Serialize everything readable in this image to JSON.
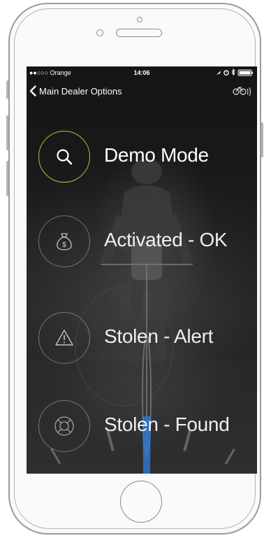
{
  "status_bar": {
    "carrier": "●●○○○ Orange",
    "time": "14:06"
  },
  "nav": {
    "back_label": "Main Dealer Options"
  },
  "menu": [
    {
      "label": "Demo Mode",
      "icon": "search-icon",
      "active": true
    },
    {
      "label": "Activated - OK",
      "icon": "money-bag-icon",
      "active": false
    },
    {
      "label": "Stolen - Alert",
      "icon": "warning-icon",
      "active": false
    },
    {
      "label": "Stolen - Found",
      "icon": "lifebuoy-icon",
      "active": false
    }
  ],
  "colors": {
    "active_ring": "#c6bb3c",
    "accent_blue": "#2f7de0",
    "text": "#ffffff"
  }
}
